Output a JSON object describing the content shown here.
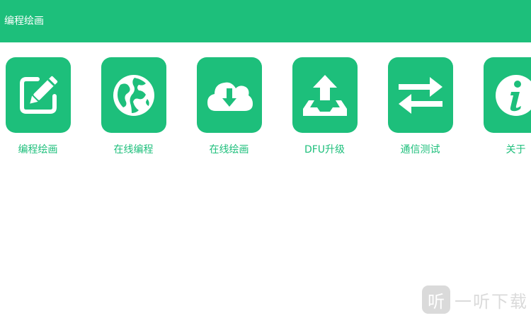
{
  "app_bar": {
    "title": "编程绘画"
  },
  "tiles": [
    {
      "label": "编程绘画",
      "icon": "pencil-edit-icon"
    },
    {
      "label": "在线编程",
      "icon": "globe-icon"
    },
    {
      "label": "在线绘画",
      "icon": "cloud-download-icon"
    },
    {
      "label": "DFU升级",
      "icon": "upload-tray-icon"
    },
    {
      "label": "通信测试",
      "icon": "swap-arrows-icon"
    },
    {
      "label": "关于",
      "icon": "info-icon"
    }
  ],
  "watermark": {
    "logo_text": "听",
    "text": "一听下载"
  },
  "colors": {
    "accent": "#1dbf7b",
    "background": "#ffffff",
    "watermark": "#bdbdbd"
  }
}
